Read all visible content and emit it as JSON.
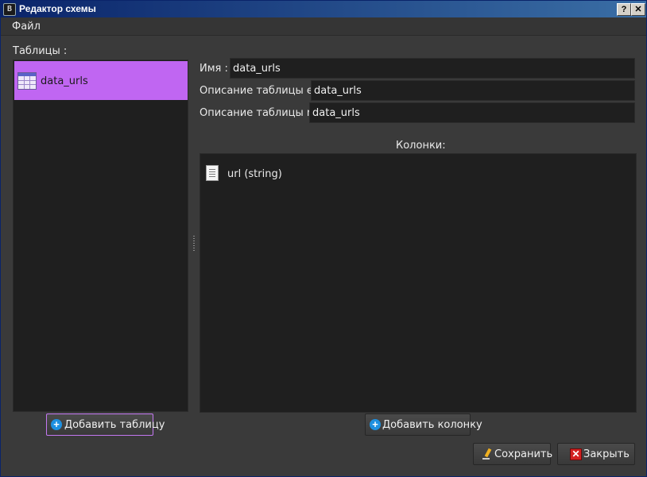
{
  "window": {
    "title": "Редактор схемы",
    "app_icon_letter": "B"
  },
  "title_buttons": {
    "help": "?",
    "close": "✕"
  },
  "menu": {
    "file": "Файл"
  },
  "tables_panel": {
    "label": "Таблицы :",
    "items": [
      {
        "name": "data_urls",
        "icon": "table-icon",
        "selected": true
      }
    ],
    "add_button": {
      "label": "Добавить таблицу",
      "icon": "plus-circle-icon"
    }
  },
  "form": {
    "name_label": "Имя :",
    "name_value": "data_urls",
    "desc_en_label": "Описание таблицы en:",
    "desc_en_value": "data_urls",
    "desc_ru_label": "Описание таблицы ru:",
    "desc_ru_value": "data_urls"
  },
  "columns_panel": {
    "label": "Колонки:",
    "items": [
      {
        "name": "url (string)",
        "icon": "document-icon"
      }
    ],
    "add_button": {
      "label": "Добавить колонку",
      "icon": "plus-circle-icon"
    }
  },
  "footer": {
    "save_label": "Сохранить",
    "save_icon": "pencil-icon",
    "close_label": "Закрыть",
    "close_icon": "close-icon"
  },
  "colors": {
    "selection": "#c066f2",
    "focus_border": "#c478f2",
    "add_icon": "#1e90e0",
    "close_icon": "#d32020"
  }
}
